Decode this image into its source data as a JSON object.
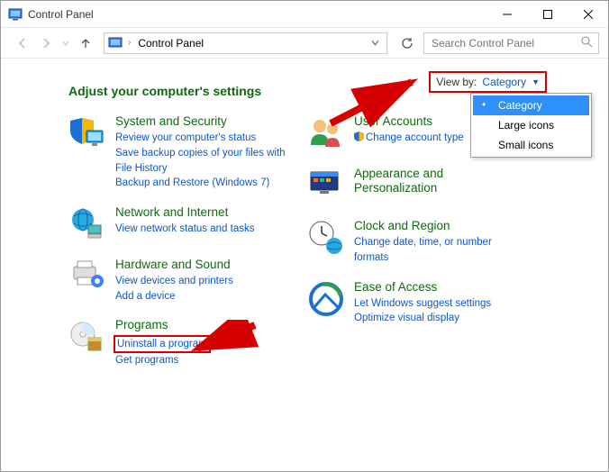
{
  "window": {
    "title": "Control Panel"
  },
  "toolbar": {
    "address": "Control Panel",
    "search_placeholder": "Search Control Panel"
  },
  "page": {
    "heading": "Adjust your computer's settings"
  },
  "viewby": {
    "label": "View by:",
    "value": "Category",
    "options": [
      "Category",
      "Large icons",
      "Small icons"
    ],
    "selected_index": 0
  },
  "categories": {
    "left": [
      {
        "title": "System and Security",
        "icon": "shield-monitor-icon",
        "links": [
          "Review your computer's status",
          "Save backup copies of your files with File History",
          "Backup and Restore (Windows 7)"
        ]
      },
      {
        "title": "Network and Internet",
        "icon": "globe-network-icon",
        "links": [
          "View network status and tasks"
        ]
      },
      {
        "title": "Hardware and Sound",
        "icon": "printer-icon",
        "links": [
          "View devices and printers",
          "Add a device"
        ]
      },
      {
        "title": "Programs",
        "icon": "disc-box-icon",
        "links": [
          "Uninstall a program",
          "Get programs"
        ],
        "highlight_link_index": 0
      }
    ],
    "right": [
      {
        "title": "User Accounts",
        "icon": "people-icon",
        "links": [
          "Change account type"
        ],
        "shield_link_index": 0
      },
      {
        "title": "Appearance and Personalization",
        "icon": "monitor-paint-icon",
        "links": []
      },
      {
        "title": "Clock and Region",
        "icon": "clock-globe-icon",
        "links": [
          "Change date, time, or number formats"
        ]
      },
      {
        "title": "Ease of Access",
        "icon": "ease-access-icon",
        "links": [
          "Let Windows suggest settings",
          "Optimize visual display"
        ]
      }
    ]
  }
}
